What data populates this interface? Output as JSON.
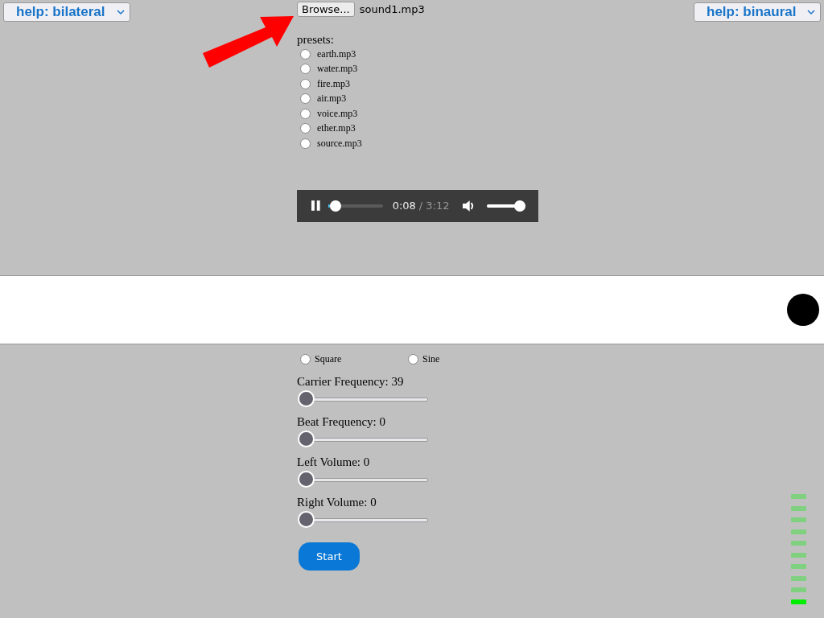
{
  "help_left": {
    "label": "help: bilateral"
  },
  "help_right": {
    "label": "help: binaural"
  },
  "file": {
    "button": "Browse...",
    "filename": "sound1.mp3"
  },
  "presets": {
    "label": "presets:",
    "items": [
      {
        "label": "earth.mp3",
        "selected": false
      },
      {
        "label": "water.mp3",
        "selected": false
      },
      {
        "label": "fire.mp3",
        "selected": false
      },
      {
        "label": "air.mp3",
        "selected": false
      },
      {
        "label": "voice.mp3",
        "selected": false
      },
      {
        "label": "ether.mp3",
        "selected": false
      },
      {
        "label": "source.mp3",
        "selected": false
      }
    ]
  },
  "player": {
    "playing": true,
    "progress": {
      "level": 0.04
    },
    "time": "0:08",
    "duration": "/ 3:12",
    "volume": {
      "level": 1
    }
  },
  "waveforms": [
    {
      "label": "Square",
      "selected": false
    },
    {
      "label": "Sine",
      "selected": false
    }
  ],
  "sliders": [
    {
      "label": "Carrier Frequency: 39",
      "level": 0
    },
    {
      "label": "Beat Frequency: 0",
      "level": 0
    },
    {
      "label": "Left Volume: 0",
      "level": 0
    },
    {
      "label": "Right Volume: 0",
      "level": 0
    }
  ],
  "start_button": "Start",
  "meter": {
    "level": 0.1
  }
}
